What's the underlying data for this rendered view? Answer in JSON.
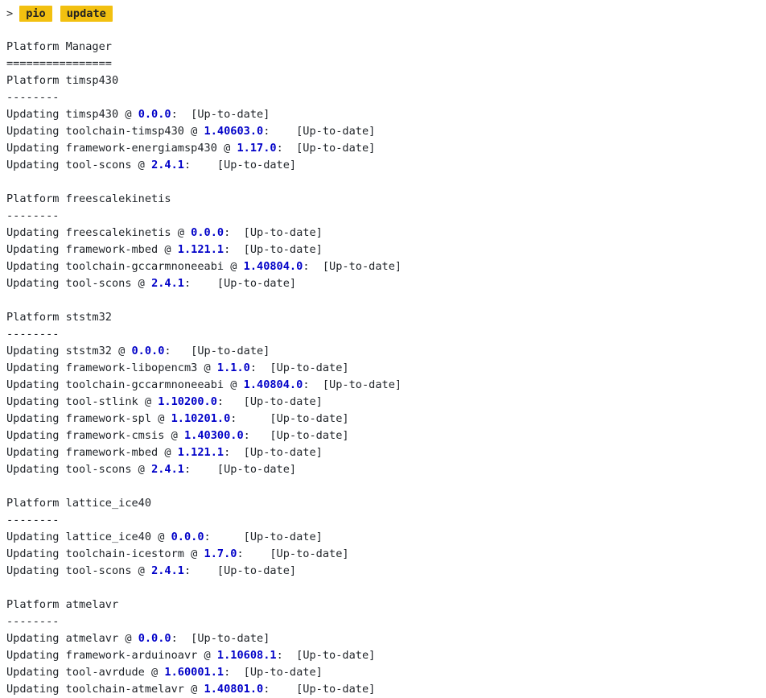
{
  "prompt": {
    "symbol": ">",
    "command": "pio",
    "argument": "update"
  },
  "output": {
    "header": "Platform Manager",
    "header_rule": "================",
    "rule": "--------",
    "platforms": [
      {
        "title": "Platform timsp430",
        "updates": [
          {
            "prefix": "Updating timsp430 @ ",
            "version": "0.0.0",
            "suffix": ":  [Up-to-date]"
          },
          {
            "prefix": "Updating toolchain-timsp430 @ ",
            "version": "1.40603.0",
            "suffix": ":    [Up-to-date]"
          },
          {
            "prefix": "Updating framework-energiamsp430 @ ",
            "version": "1.17.0",
            "suffix": ":  [Up-to-date]"
          },
          {
            "prefix": "Updating tool-scons @ ",
            "version": "2.4.1",
            "suffix": ":    [Up-to-date]"
          }
        ]
      },
      {
        "title": "Platform freescalekinetis",
        "updates": [
          {
            "prefix": "Updating freescalekinetis @ ",
            "version": "0.0.0",
            "suffix": ":  [Up-to-date]"
          },
          {
            "prefix": "Updating framework-mbed @ ",
            "version": "1.121.1",
            "suffix": ":  [Up-to-date]"
          },
          {
            "prefix": "Updating toolchain-gccarmnoneeabi @ ",
            "version": "1.40804.0",
            "suffix": ":  [Up-to-date]"
          },
          {
            "prefix": "Updating tool-scons @ ",
            "version": "2.4.1",
            "suffix": ":    [Up-to-date]"
          }
        ]
      },
      {
        "title": "Platform ststm32",
        "updates": [
          {
            "prefix": "Updating ststm32 @ ",
            "version": "0.0.0",
            "suffix": ":   [Up-to-date]"
          },
          {
            "prefix": "Updating framework-libopencm3 @ ",
            "version": "1.1.0",
            "suffix": ":  [Up-to-date]"
          },
          {
            "prefix": "Updating toolchain-gccarmnoneeabi @ ",
            "version": "1.40804.0",
            "suffix": ":  [Up-to-date]"
          },
          {
            "prefix": "Updating tool-stlink @ ",
            "version": "1.10200.0",
            "suffix": ":   [Up-to-date]"
          },
          {
            "prefix": "Updating framework-spl @ ",
            "version": "1.10201.0",
            "suffix": ":     [Up-to-date]"
          },
          {
            "prefix": "Updating framework-cmsis @ ",
            "version": "1.40300.0",
            "suffix": ":   [Up-to-date]"
          },
          {
            "prefix": "Updating framework-mbed @ ",
            "version": "1.121.1",
            "suffix": ":  [Up-to-date]"
          },
          {
            "prefix": "Updating tool-scons @ ",
            "version": "2.4.1",
            "suffix": ":    [Up-to-date]"
          }
        ]
      },
      {
        "title": "Platform lattice_ice40",
        "updates": [
          {
            "prefix": "Updating lattice_ice40 @ ",
            "version": "0.0.0",
            "suffix": ":     [Up-to-date]"
          },
          {
            "prefix": "Updating toolchain-icestorm @ ",
            "version": "1.7.0",
            "suffix": ":    [Up-to-date]"
          },
          {
            "prefix": "Updating tool-scons @ ",
            "version": "2.4.1",
            "suffix": ":    [Up-to-date]"
          }
        ]
      },
      {
        "title": "Platform atmelavr",
        "updates": [
          {
            "prefix": "Updating atmelavr @ ",
            "version": "0.0.0",
            "suffix": ":  [Up-to-date]"
          },
          {
            "prefix": "Updating framework-arduinoavr @ ",
            "version": "1.10608.1",
            "suffix": ":  [Up-to-date]"
          },
          {
            "prefix": "Updating tool-avrdude @ ",
            "version": "1.60001.1",
            "suffix": ":  [Up-to-date]"
          },
          {
            "prefix": "Updating toolchain-atmelavr @ ",
            "version": "1.40801.0",
            "suffix": ":    [Up-to-date]"
          }
        ]
      }
    ]
  },
  "colors": {
    "chip_background": "#f2c010",
    "version_text": "#0000c8",
    "text": "#1f2328"
  }
}
